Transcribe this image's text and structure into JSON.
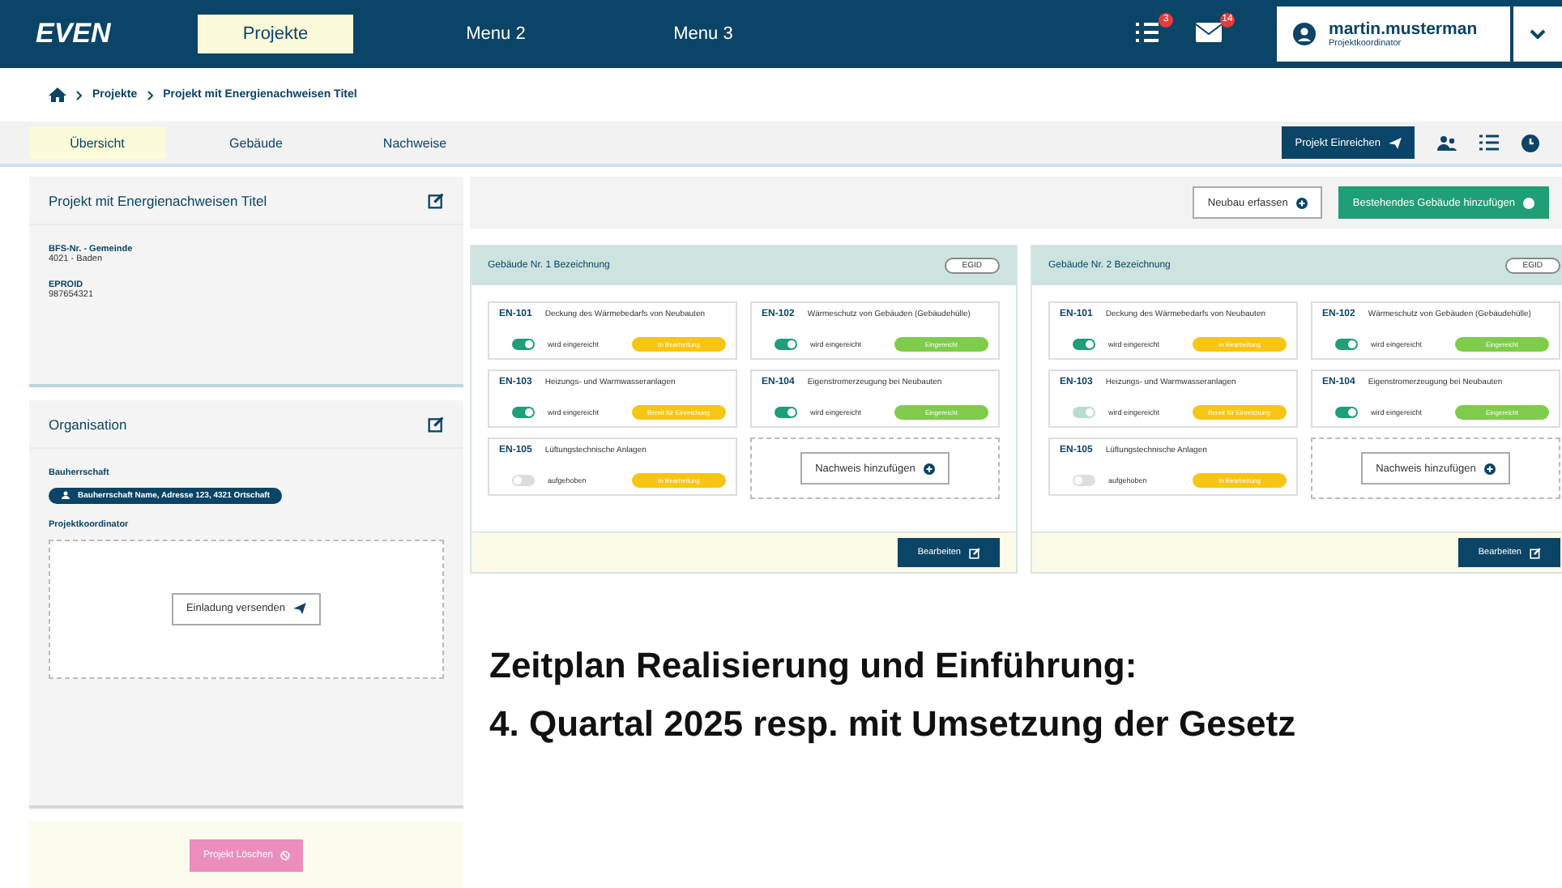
{
  "header": {
    "logo": "EVEN",
    "menu": [
      {
        "label": "Projekte",
        "selected": true
      },
      {
        "label": "Menu 2",
        "selected": false
      },
      {
        "label": "Menu 3",
        "selected": false
      }
    ],
    "task_count": "3",
    "mail_count": "14",
    "user": {
      "name": "martin.musterman",
      "role": "Projektkoordinator"
    }
  },
  "breadcrumb": [
    "Projekte",
    "Projekt mit Energienachweisen Titel"
  ],
  "tabs": [
    {
      "label": "Übersicht",
      "selected": true
    },
    {
      "label": "Gebäude",
      "selected": false
    },
    {
      "label": "Nachweise",
      "selected": false
    }
  ],
  "submit_button": "Projekt Einreichen",
  "project": {
    "title": "Projekt mit Energienachweisen Titel",
    "fields": [
      {
        "label": "BFS-Nr. - Gemeinde",
        "value": "4021 - Baden"
      },
      {
        "label": "EPROID",
        "value": "987654321"
      }
    ]
  },
  "organisation": {
    "title": "Organisation",
    "owner_label": "Bauherrschaft",
    "owner": "Bauherrschaft Name, Adresse 123, 4321 Ortschaft",
    "coordinator_label": "Projektkoordinator",
    "invite_button": "Einladung versenden"
  },
  "delete_button": "Projekt Löschen",
  "actions": [
    "Neubau erfassen",
    "Bestehendes Gebäude hinzufügen"
  ],
  "buildings": [
    {
      "title": "Gebäude Nr. 1 Bezeichnung",
      "egid": "EGID",
      "add_button": "Nachweis hinzufügen",
      "edit_button": "Bearbeiten",
      "proofs": [
        {
          "code": "EN-101",
          "name": "Deckung des Wärmebedarfs von Neubauten",
          "on": true,
          "disabled": false,
          "toggle_label": "wird eingereicht",
          "status": "In Bearbeitung",
          "color": "#f7c514"
        },
        {
          "code": "EN-102",
          "name": "Wärmeschutz von Gebäuden (Gebäudehülle)",
          "on": true,
          "disabled": false,
          "toggle_label": "wird eingereicht",
          "status": "Eingereicht",
          "color": "#7fcb4b"
        },
        {
          "code": "EN-103",
          "name": "Heizungs- und Warmwasseranlagen",
          "on": true,
          "disabled": false,
          "toggle_label": "wird eingereicht",
          "status": "Bereit für Einreichung",
          "color": "#f7c514"
        },
        {
          "code": "EN-104",
          "name": "Eigenstromerzeugung bei Neubauten",
          "on": true,
          "disabled": false,
          "toggle_label": "wird eingereicht",
          "status": "Eingereicht",
          "color": "#7fcb4b"
        },
        {
          "code": "EN-105",
          "name": "Lüftungstechnische Anlagen",
          "on": false,
          "disabled": false,
          "toggle_label": "aufgehoben",
          "status": "In Bearbeitung",
          "color": "#f7c514"
        }
      ]
    },
    {
      "title": "Gebäude Nr. 2 Bezeichnung",
      "egid": "EGID",
      "add_button": "Nachweis hinzufügen",
      "edit_button": "Bearbeiten",
      "proofs": [
        {
          "code": "EN-101",
          "name": "Deckung des Wärmebedarfs von Neubauten",
          "on": true,
          "disabled": false,
          "toggle_label": "wird eingereicht",
          "status": "In Bearbeitung",
          "color": "#f7c514"
        },
        {
          "code": "EN-102",
          "name": "Wärmeschutz von Gebäuden (Gebäudehülle)",
          "on": true,
          "disabled": false,
          "toggle_label": "wird eingereicht",
          "status": "Eingereicht",
          "color": "#7fcb4b"
        },
        {
          "code": "EN-103",
          "name": "Heizungs- und Warmwasseranlagen",
          "on": true,
          "disabled": true,
          "toggle_label": "wird eingereicht",
          "status": "Bereit für Einreichung",
          "color": "#f7c514"
        },
        {
          "code": "EN-104",
          "name": "Eigenstromerzeugung bei Neubauten",
          "on": true,
          "disabled": false,
          "toggle_label": "wird eingereicht",
          "status": "Eingereicht",
          "color": "#7fcb4b"
        },
        {
          "code": "EN-105",
          "name": "Lüftungstechnische Anlagen",
          "on": false,
          "disabled": false,
          "toggle_label": "aufgehoben",
          "status": "In Bearbeitung",
          "color": "#f7c514"
        }
      ]
    }
  ],
  "announcement": [
    "Zeitplan Realisierung und Einführung:",
    "4. Quartal 2025 resp. mit Umsetzung der Gesetz"
  ]
}
